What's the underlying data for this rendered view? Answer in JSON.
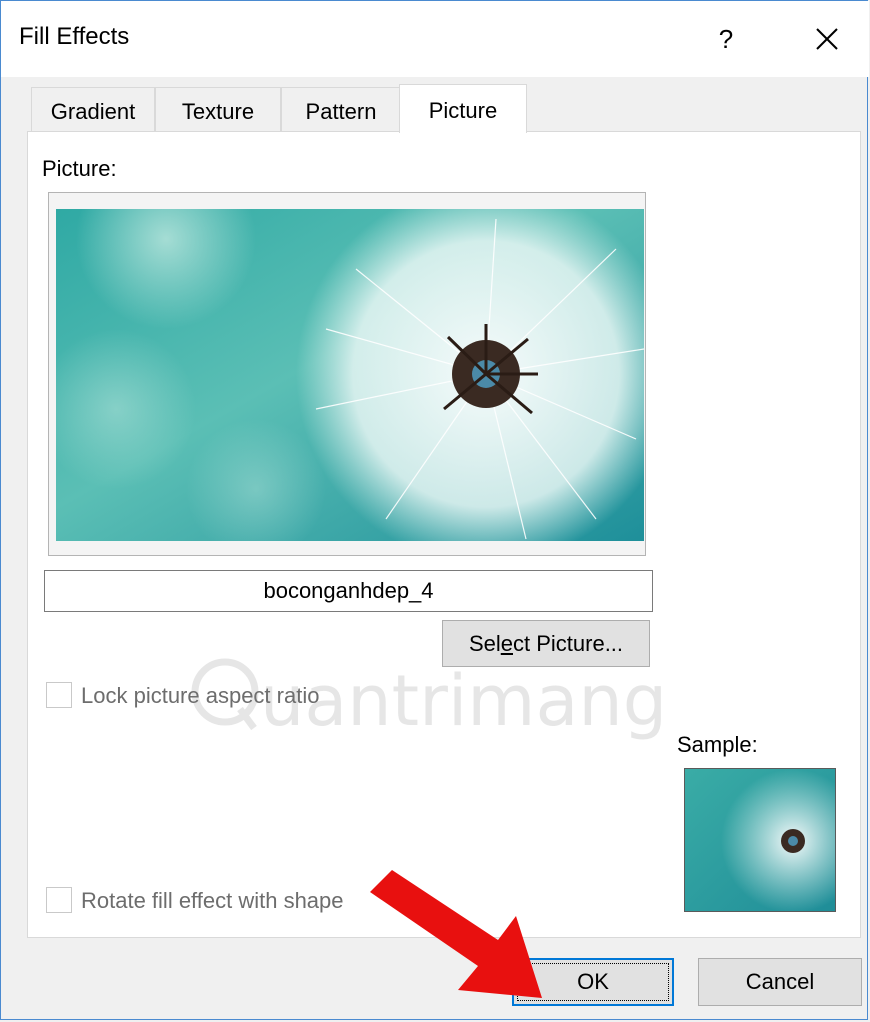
{
  "dialog": {
    "title": "Fill Effects",
    "help_glyph": "?",
    "close_icon": "close-icon"
  },
  "tabs": [
    {
      "label": "Gradient",
      "active": false
    },
    {
      "label": "Texture",
      "active": false
    },
    {
      "label": "Pattern",
      "active": false
    },
    {
      "label": "Picture",
      "active": true
    }
  ],
  "picture_section": {
    "label": "Picture:",
    "image_description_icon": "dandelion-picture",
    "filename": "boconganhdep_4",
    "select_button_label_pre": "Sel",
    "select_button_label_mnemonic": "e",
    "select_button_label_post": "ct Picture..."
  },
  "options": {
    "lock_aspect_ratio": {
      "label": "Lock picture aspect ratio",
      "checked": false,
      "enabled": false
    },
    "rotate_with_shape": {
      "label": "Rotate fill effect with shape",
      "checked": false,
      "enabled": false
    }
  },
  "sample": {
    "label": "Sample:"
  },
  "buttons": {
    "ok_label": "OK",
    "cancel_label": "Cancel"
  },
  "watermark": {
    "text": "uantrimang"
  },
  "colors": {
    "accent": "#0078d7",
    "arrow": "#e8100f"
  }
}
